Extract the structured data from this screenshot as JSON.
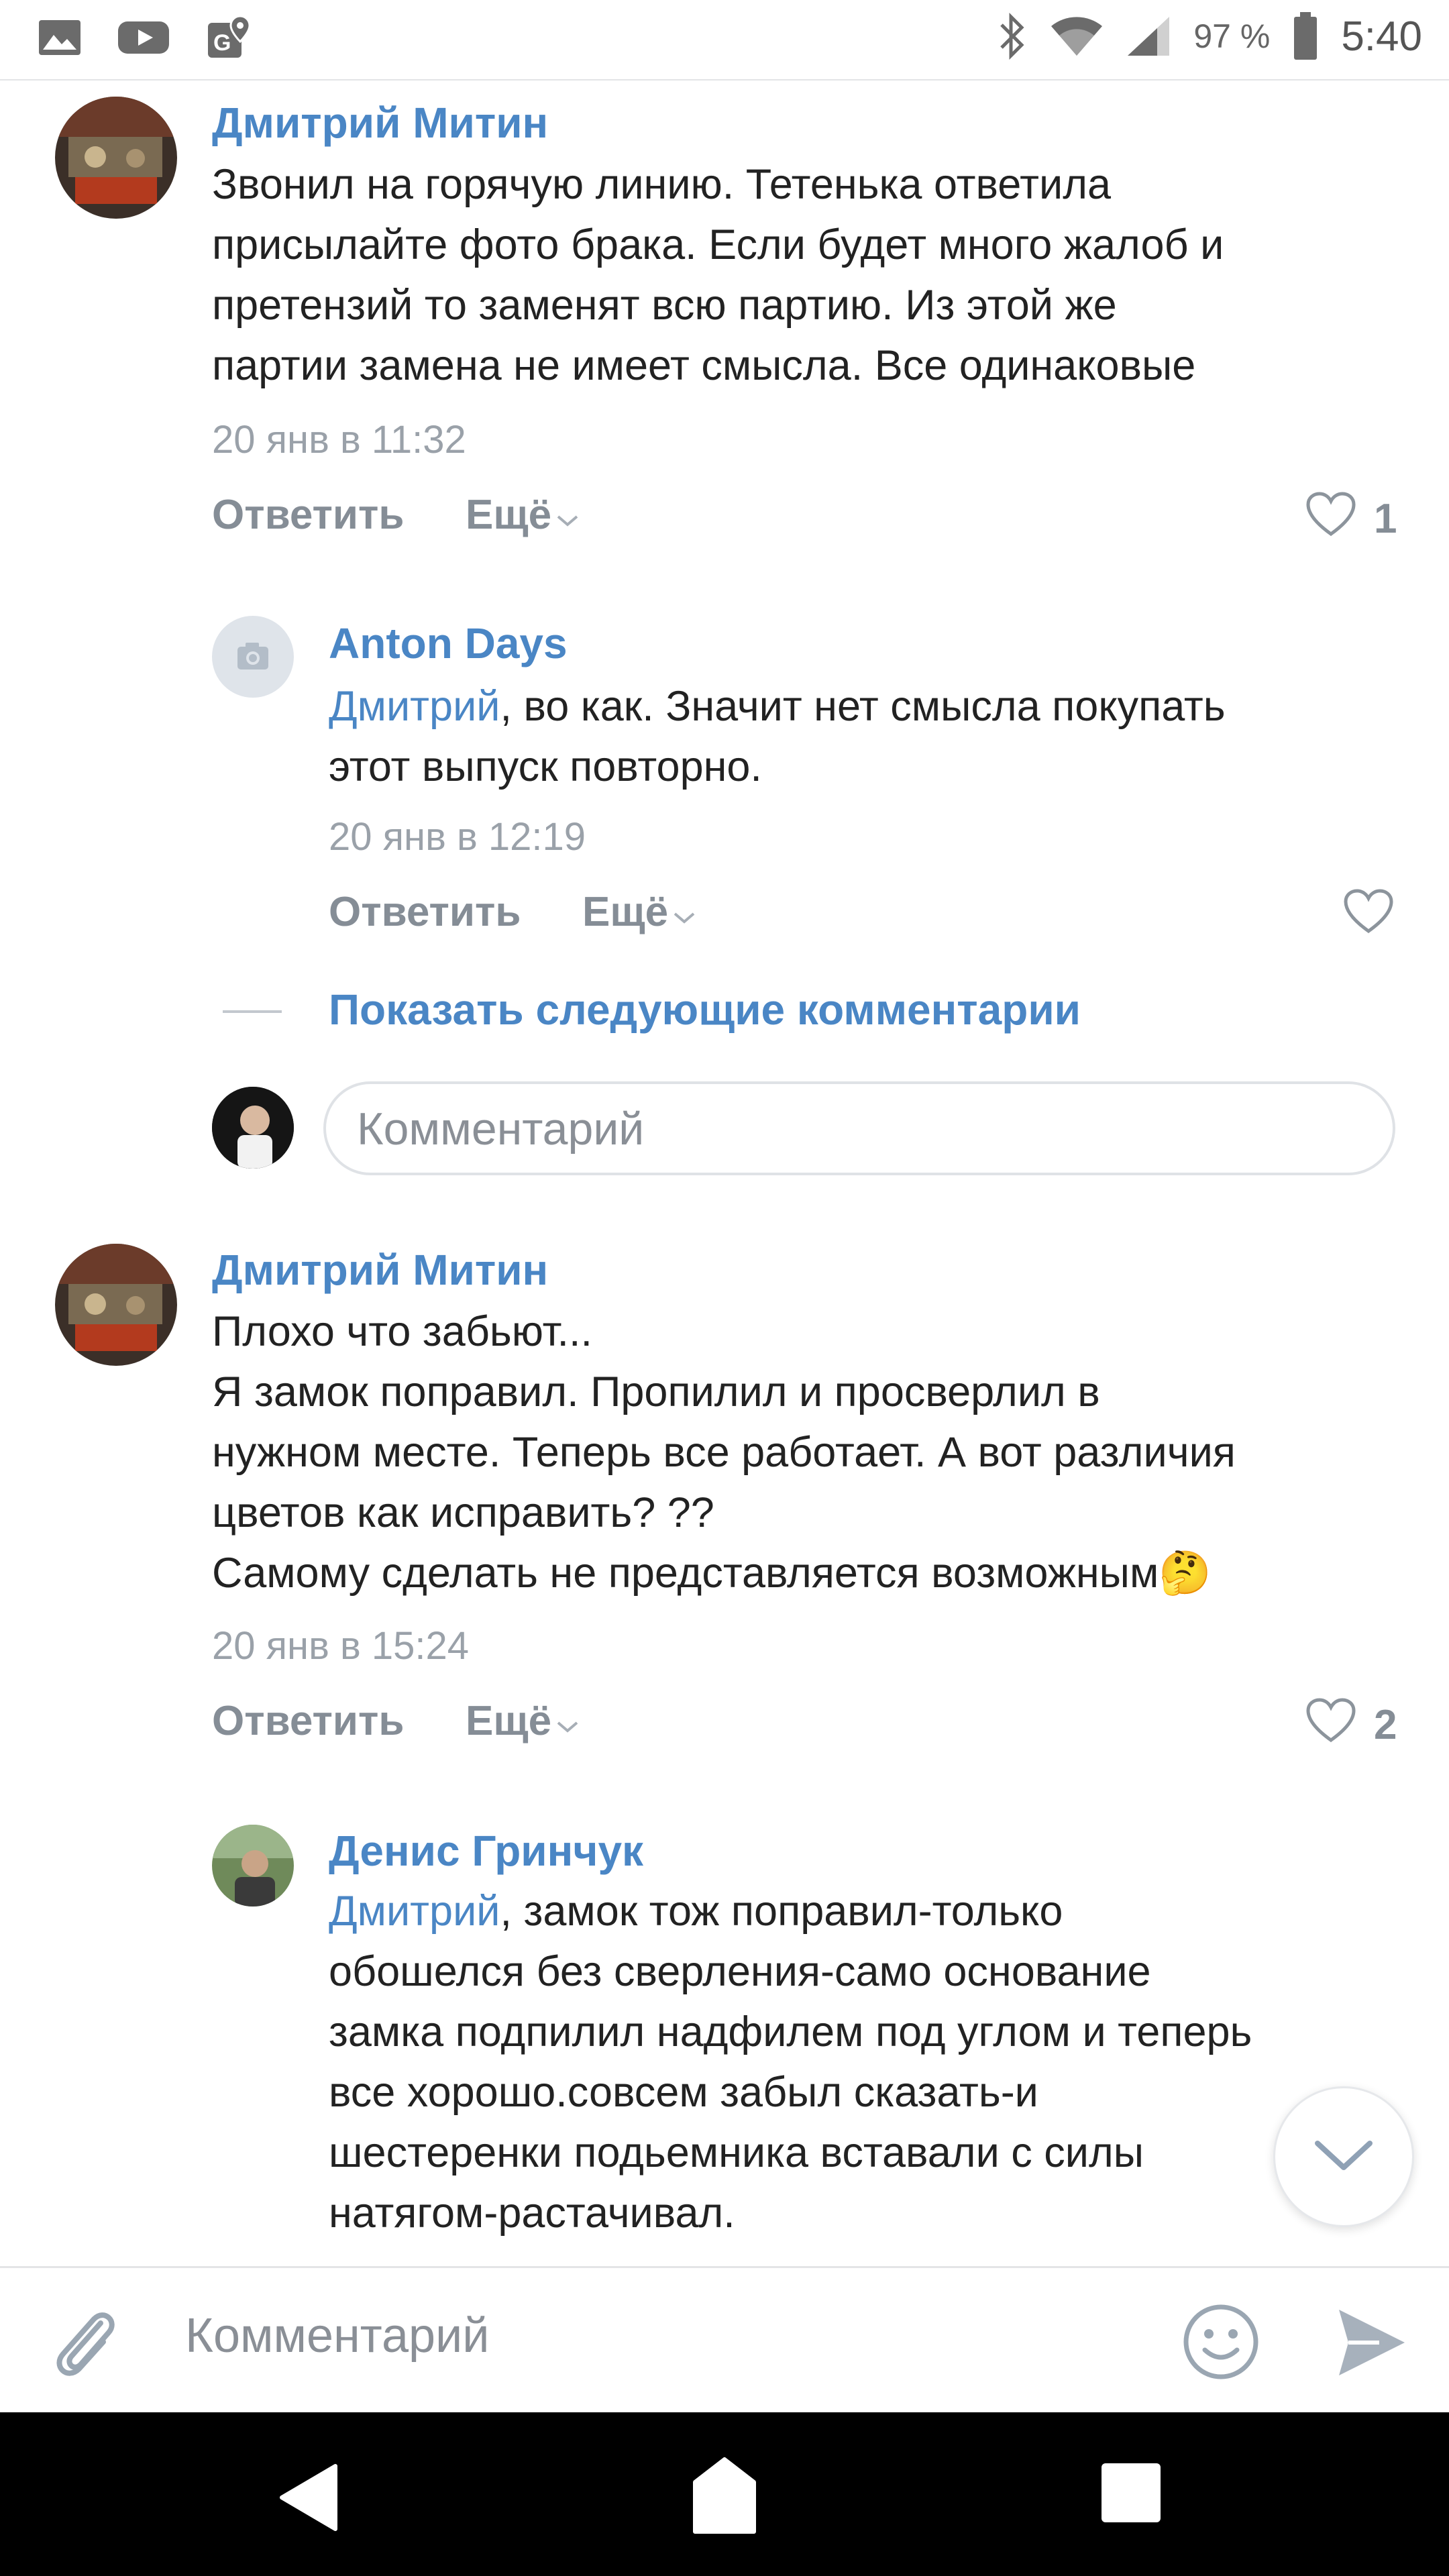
{
  "status_bar": {
    "battery_percent": "97 %",
    "time": "5:40"
  },
  "comments": [
    {
      "author": "Дмитрий Митин",
      "text": "Звонил на горячую линию. Тетенька ответила\nприсылайте фото брака. Если будет много жалоб и\nпретензий то заменят всю партию. Из этой же\nпартии замена не имеет смысла. Все одинаковые",
      "time": "20 янв в 11:32",
      "reply_label": "Ответить",
      "more_label": "Ещё",
      "likes": "1"
    },
    {
      "author": "Anton Days",
      "mention": "Дмитрий",
      "text": ", во как. Значит нет смысла покупать\nэтот выпуск повторно.",
      "time": "20 янв в 12:19",
      "reply_label": "Ответить",
      "more_label": "Ещё"
    },
    {
      "author": "Дмитрий Митин",
      "text": "Плохо что забьют...\nЯ замок поправил. Пропилил и просверлил в\nнужном месте. Теперь все работает. А вот различия\nцветов как исправить? ??\nСамому сделать не представляется возможным",
      "emoji": "🤔",
      "time": "20 янв в 15:24",
      "reply_label": "Ответить",
      "more_label": "Ещё",
      "likes": "2"
    },
    {
      "author": "Денис Гринчук",
      "mention": "Дмитрий",
      "text": ", замок тож поправил-только\nобошелся без сверления-само основание\nзамка подпилил надфилем под углом и теперь\nвсе хорошо.совсем забыл сказать-и\nшестеренки подьемника вставали с силы\nнатягом-растачивал."
    }
  ],
  "show_more_label": "Показать следующие комментарии",
  "reply_input_placeholder": "Комментарий",
  "composer_placeholder": "Комментарий",
  "colors": {
    "link": "#4a86c5",
    "meta": "#9aa1a9",
    "action": "#858d96"
  }
}
